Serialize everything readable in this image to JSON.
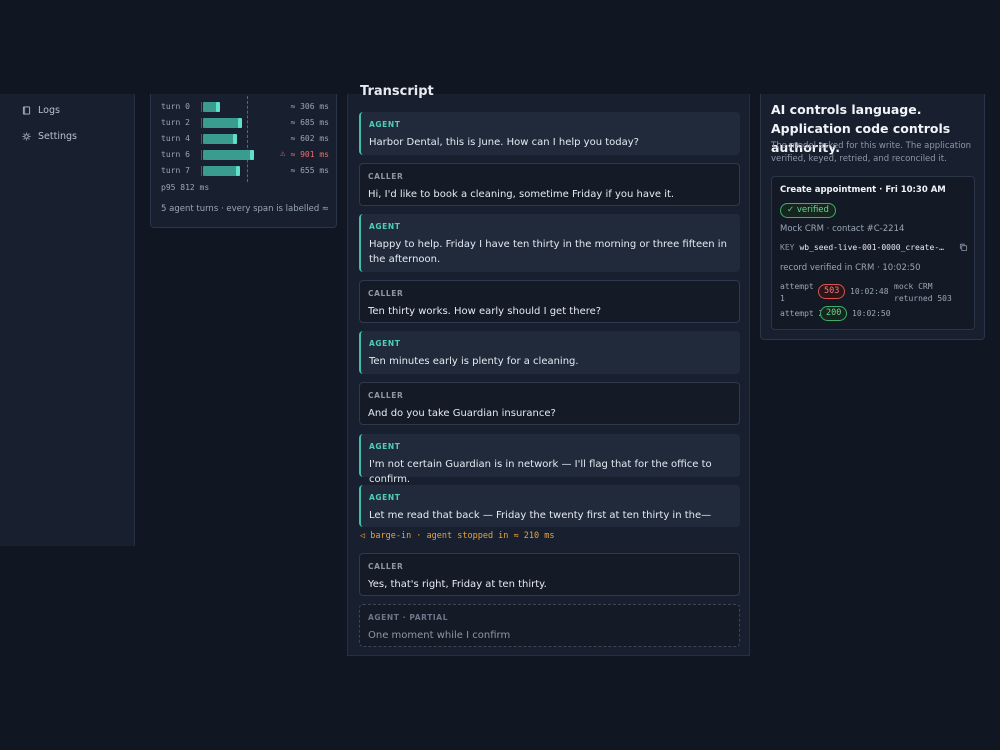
{
  "sidebar": {
    "items": [
      {
        "label": "Logs",
        "icon": "book-icon"
      },
      {
        "label": "Settings",
        "icon": "gear-icon"
      }
    ]
  },
  "latency": {
    "turns": [
      {
        "label": "turn 0",
        "value": "≈ 306 ms",
        "ms": 306,
        "warn": false
      },
      {
        "label": "turn 2",
        "value": "≈ 685 ms",
        "ms": 685,
        "warn": false
      },
      {
        "label": "turn 4",
        "value": "≈ 602 ms",
        "ms": 602,
        "warn": false
      },
      {
        "label": "turn 6",
        "value": "≈ 901 ms",
        "ms": 901,
        "warn": true
      },
      {
        "label": "turn 7",
        "value": "≈ 655 ms",
        "ms": 655,
        "warn": false
      }
    ],
    "p95": "p95 812 ms",
    "footer": "5 agent turns · every span is labelled ≈"
  },
  "transcript": {
    "title": "Transcript",
    "turns": [
      {
        "speaker": "AGENT",
        "text": "Harbor Dental, this is June. How can I help you today?"
      },
      {
        "speaker": "CALLER",
        "text": "Hi, I'd like to book a cleaning, sometime Friday if you have it."
      },
      {
        "speaker": "AGENT",
        "text": "Happy to help. Friday I have ten thirty in the morning or three fifteen in the afternoon."
      },
      {
        "speaker": "CALLER",
        "text": "Ten thirty works. How early should I get there?"
      },
      {
        "speaker": "AGENT",
        "text": "Ten minutes early is plenty for a cleaning."
      },
      {
        "speaker": "CALLER",
        "text": "And do you take Guardian insurance?"
      },
      {
        "speaker": "AGENT",
        "text": "I'm not certain Guardian is in network — I'll flag that for the office to confirm."
      },
      {
        "speaker": "AGENT",
        "text": "Let me read that back — Friday the twenty first at ten thirty in the—"
      },
      {
        "speaker": "CALLER",
        "text": "Yes, that's right, Friday at ten thirty."
      },
      {
        "speaker": "AGENT · PARTIAL",
        "text": "One moment while I confirm"
      }
    ],
    "barge_in": "barge-in · agent stopped in ≈ 210 ms"
  },
  "authority": {
    "title": "AI controls language. Application code controls authority.",
    "subtitle": "The model asked for this write. The application verified, keyed, retried, and reconciled it.",
    "appointment": {
      "title": "Create appointment · Fri 10:30 AM",
      "badge": "verified",
      "crm": "Mock CRM · contact #C-2214",
      "key_label": "KEY",
      "key_value": "wb_seed-live-001-0000_create-…",
      "record": "record verified in CRM · 10:02:50",
      "attempts": [
        {
          "label": "attempt 1",
          "code": "503",
          "time": "10:02:48",
          "note": "mock CRM returned 503"
        },
        {
          "label": "attempt 2",
          "code": "200",
          "time": "10:02:50",
          "note": ""
        }
      ]
    }
  },
  "colors": {
    "accent": "#3fbfa8",
    "warn": "#ef6b6b",
    "barge": "#e8a33c",
    "ok": "#6fd192"
  }
}
